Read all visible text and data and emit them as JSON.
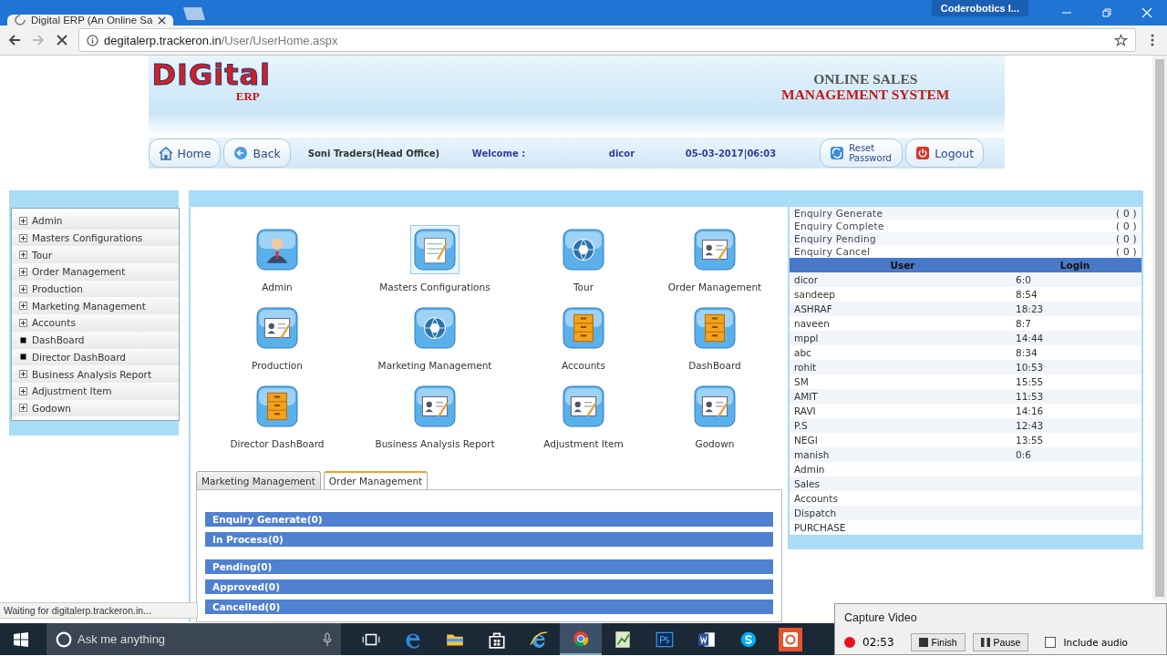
{
  "browser": {
    "tab_title": "Digital ERP (An Online Sa",
    "profile": "Coderobotics I...",
    "url_host": "degitalerp.trackeron.in",
    "url_path": "/User/UserHome.aspx"
  },
  "banner": {
    "logo": "DIGital",
    "logo_sub": "ERP",
    "title_top": "ONLINE SALES",
    "title_bottom": "MANAGEMENT SYSTEM"
  },
  "navbar": {
    "home": "Home",
    "back": "Back",
    "company": "Soni Traders(Head Office)",
    "welcome": "Welcome :",
    "user": "dicor",
    "datetime": "05-03-2017|06:03",
    "reset": "Reset Password",
    "logout": "Logout"
  },
  "sidebar": [
    {
      "label": "Admin",
      "expandable": true
    },
    {
      "label": "Masters Configurations",
      "expandable": true
    },
    {
      "label": "Tour",
      "expandable": true
    },
    {
      "label": "Order Management",
      "expandable": true
    },
    {
      "label": "Production",
      "expandable": true
    },
    {
      "label": "Marketing Management",
      "expandable": true
    },
    {
      "label": "Accounts",
      "expandable": true
    },
    {
      "label": "DashBoard",
      "expandable": false
    },
    {
      "label": "Director DashBoard",
      "expandable": false
    },
    {
      "label": "Business Analysis Report",
      "expandable": true
    },
    {
      "label": "Adjustment Item",
      "expandable": true
    },
    {
      "label": "Godown",
      "expandable": true
    }
  ],
  "modules": [
    {
      "label": "Admin",
      "kind": "person",
      "selected": false
    },
    {
      "label": "Masters Configurations",
      "kind": "notepad",
      "selected": true
    },
    {
      "label": "Tour",
      "kind": "globe",
      "selected": false
    },
    {
      "label": "Order Management",
      "kind": "document",
      "selected": false
    },
    {
      "label": "Production",
      "kind": "document",
      "selected": false
    },
    {
      "label": "Marketing Management",
      "kind": "globe",
      "selected": false
    },
    {
      "label": "Accounts",
      "kind": "cabinet",
      "selected": false
    },
    {
      "label": "DashBoard",
      "kind": "cabinet",
      "selected": false
    },
    {
      "label": "Director DashBoard",
      "kind": "cabinet",
      "selected": false
    },
    {
      "label": "Business Analysis Report",
      "kind": "document",
      "selected": false
    },
    {
      "label": "Adjustment Item",
      "kind": "document",
      "selected": false
    },
    {
      "label": "Godown",
      "kind": "document",
      "selected": false
    }
  ],
  "tabs": [
    {
      "label": "Marketing Management",
      "selected": false
    },
    {
      "label": "Order Management",
      "selected": true
    }
  ],
  "status_bars": [
    "Enquiry Generate(0)",
    "In Process(0)",
    "Pending(0)",
    "Approved(0)",
    "Cancelled(0)"
  ],
  "enquiries": [
    {
      "label": "Enquiry Generate",
      "count": "( 0 )"
    },
    {
      "label": "Enquiry Complete",
      "count": "( 0 )"
    },
    {
      "label": "Enquiry Pending",
      "count": "( 0 )"
    },
    {
      "label": "Enquiry Cancel",
      "count": "( 0 )"
    }
  ],
  "logins": {
    "columns": [
      "User",
      "Login"
    ],
    "rows": [
      {
        "user": "dicor",
        "login": "6:0"
      },
      {
        "user": "sandeep",
        "login": "8:54"
      },
      {
        "user": "ASHRAF",
        "login": "18:23"
      },
      {
        "user": "naveen",
        "login": "8:7"
      },
      {
        "user": "mppl",
        "login": "14:44"
      },
      {
        "user": "abc",
        "login": "8:34"
      },
      {
        "user": "rohit",
        "login": "10:53"
      },
      {
        "user": "SM",
        "login": "15:55"
      },
      {
        "user": "AMIT",
        "login": "11:53"
      },
      {
        "user": "RAVI",
        "login": "14:16"
      },
      {
        "user": "P.S",
        "login": "12:43"
      },
      {
        "user": "NEGI",
        "login": "13:55"
      },
      {
        "user": "manish",
        "login": "0:6"
      },
      {
        "user": "Admin"
      },
      {
        "user": "Sales"
      },
      {
        "user": "Accounts"
      },
      {
        "user": "Dispatch"
      },
      {
        "user": "PURCHASE"
      }
    ]
  },
  "status_text": "Waiting for digitalerp.trackeron.in...",
  "taskbar": {
    "search": "Ask me anything"
  },
  "capture": {
    "title": "Capture Video",
    "time": "02:53",
    "finish": "Finish",
    "pause": "Pause",
    "include_audio": "Include audio",
    "audio_checked": false
  }
}
